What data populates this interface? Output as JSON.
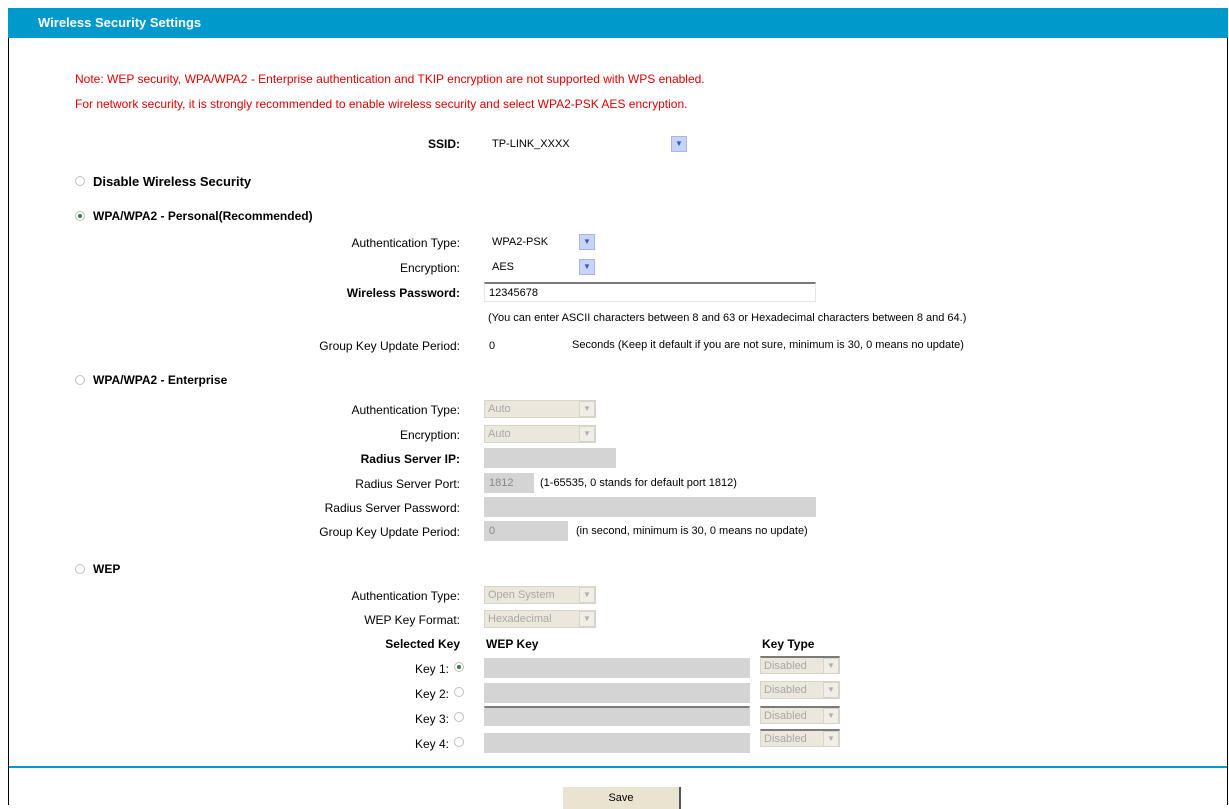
{
  "title": "Wireless Security Settings",
  "notes": [
    "Note: WEP security, WPA/WPA2 - Enterprise authentication and TKIP encryption are not supported with WPS enabled.",
    "For network security, it is strongly recommended to enable wireless security and select WPA2-PSK AES encryption."
  ],
  "ssid": {
    "label": "SSID:",
    "value": "TP-LINK_XXXX"
  },
  "disable": {
    "label": "Disable Wireless Security"
  },
  "psk": {
    "label": "WPA/WPA2 - Personal(Recommended)",
    "auth_label": "Authentication Type:",
    "auth_value": "WPA2-PSK",
    "enc_label": "Encryption:",
    "enc_value": "AES",
    "pwd_label": "Wireless Password:",
    "pwd_value": "12345678",
    "pwd_hint": "(You can enter ASCII characters between 8 and 63 or Hexadecimal characters between 8 and 64.)",
    "gkp_label": "Group Key Update Period:",
    "gkp_value": "0",
    "gkp_hint": "Seconds (Keep it default if you are not sure, minimum is 30, 0 means no update)"
  },
  "ent": {
    "label": "WPA/WPA2 - Enterprise",
    "auth_label": "Authentication Type:",
    "auth_value": "Auto",
    "enc_label": "Encryption:",
    "enc_value": "Auto",
    "radius_ip_label": "Radius Server IP:",
    "radius_port_label": "Radius Server Port:",
    "radius_port_value": "1812",
    "radius_port_hint": "(1-65535, 0 stands for default port 1812)",
    "radius_pwd_label": "Radius Server Password:",
    "gkp_label": "Group Key Update Period:",
    "gkp_value": "0",
    "gkp_hint": "(in second, minimum is 30, 0 means no update)"
  },
  "wep": {
    "label": "WEP",
    "auth_label": "Authentication Type:",
    "auth_value": "Open System",
    "fmt_label": "WEP Key Format:",
    "fmt_value": "Hexadecimal",
    "col_selected": "Selected Key",
    "col_key": "WEP Key",
    "col_type": "Key Type",
    "keys": [
      {
        "label": "Key 1:",
        "type": "Disabled"
      },
      {
        "label": "Key 2:",
        "type": "Disabled"
      },
      {
        "label": "Key 3:",
        "type": "Disabled"
      },
      {
        "label": "Key 4:",
        "type": "Disabled"
      }
    ]
  },
  "save_label": "Save"
}
